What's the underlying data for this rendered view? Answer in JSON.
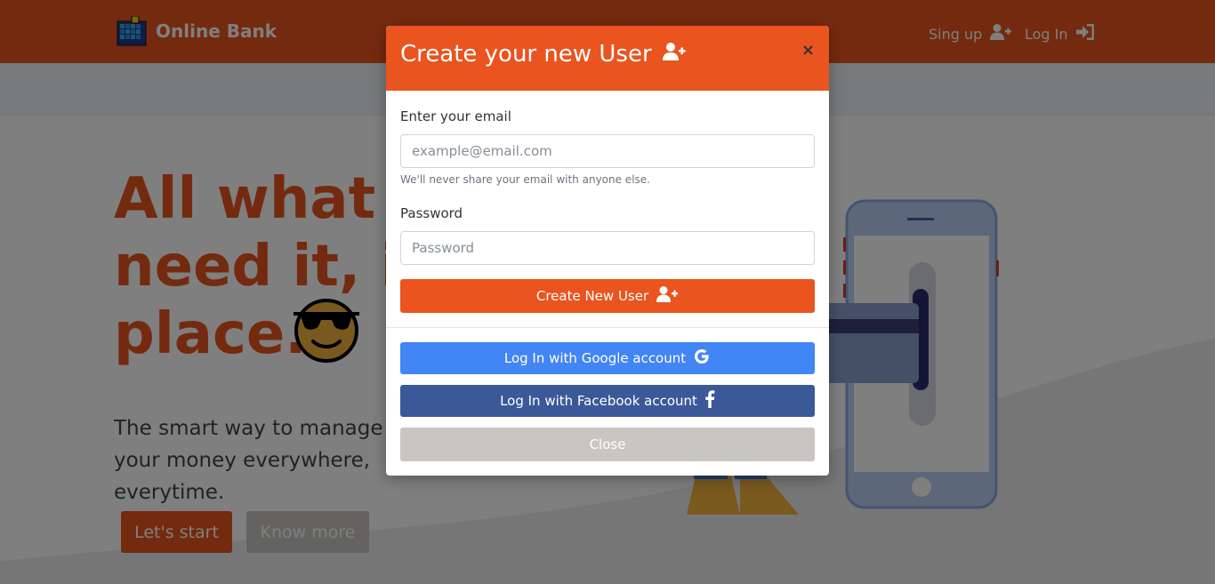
{
  "navbar": {
    "brand": "Online Bank",
    "signup_label": "Sing up",
    "login_label": "Log In"
  },
  "hero": {
    "title": "All what you\nneed it, in one\nplace.",
    "subtitle": "The smart way to manage your money everywhere, everytime.",
    "start_label": "Let's start",
    "more_label": "Know more"
  },
  "modal": {
    "title": "Create your new User",
    "close_glyph": "×",
    "email_label": "Enter your email",
    "email_placeholder": "example@email.com",
    "email_help": "We'll never share your email with anyone else.",
    "password_label": "Password",
    "password_placeholder": "Password",
    "create_label": "Create New User",
    "google_label": "Log In with Google account",
    "facebook_label": "Log In with Facebook account",
    "close_label": "Close"
  },
  "icons": {
    "user_plus": "user-plus-icon",
    "sign_in": "sign-in-icon",
    "google": "google-icon",
    "facebook": "facebook-icon",
    "emoji": "sunglasses-emoji-icon",
    "logo": "bank-logo-icon"
  },
  "colors": {
    "brand": "#e9541f",
    "google": "#4285f4",
    "facebook": "#3b5998",
    "close": "#c9c6c2"
  }
}
